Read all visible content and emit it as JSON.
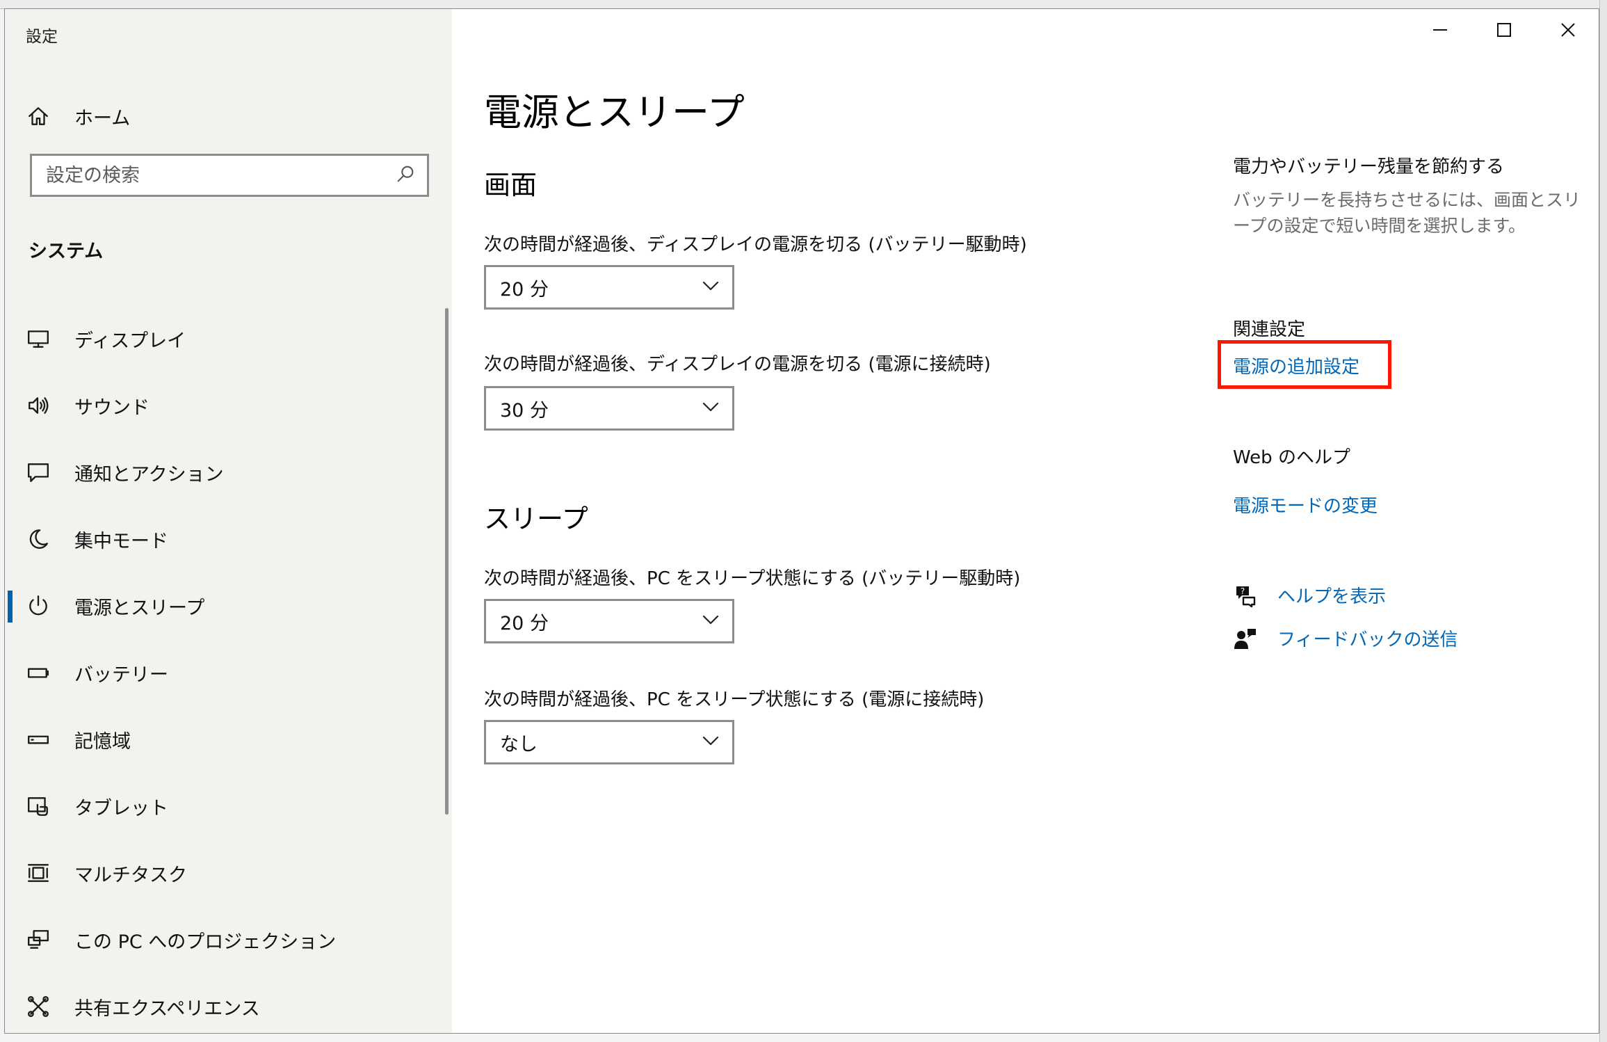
{
  "window": {
    "app_title": "設定",
    "controls": {
      "minimize": "minimize-icon",
      "maximize": "maximize-icon",
      "close": "close-icon"
    }
  },
  "sidebar": {
    "home_label": "ホーム",
    "search_placeholder": "設定の検索",
    "section_label": "システム",
    "items": [
      {
        "label": "ディスプレイ",
        "icon": "display-icon"
      },
      {
        "label": "サウンド",
        "icon": "speaker-icon"
      },
      {
        "label": "通知とアクション",
        "icon": "notification-icon"
      },
      {
        "label": "集中モード",
        "icon": "moon-icon"
      },
      {
        "label": "電源とスリープ",
        "icon": "power-icon",
        "active": true
      },
      {
        "label": "バッテリー",
        "icon": "battery-icon"
      },
      {
        "label": "記憶域",
        "icon": "storage-icon"
      },
      {
        "label": "タブレット",
        "icon": "tablet-icon"
      },
      {
        "label": "マルチタスク",
        "icon": "multitask-icon"
      },
      {
        "label": "この PC へのプロジェクション",
        "icon": "projection-icon"
      },
      {
        "label": "共有エクスペリエンス",
        "icon": "share-icon"
      }
    ]
  },
  "main": {
    "page_title": "電源とスリープ",
    "screen": {
      "title": "画面",
      "battery_label": "次の時間が経過後、ディスプレイの電源を切る (バッテリー駆動時)",
      "battery_value": "20 分",
      "plugged_label": "次の時間が経過後、ディスプレイの電源を切る (電源に接続時)",
      "plugged_value": "30 分"
    },
    "sleep": {
      "title": "スリープ",
      "battery_label": "次の時間が経過後、PC をスリープ状態にする (バッテリー駆動時)",
      "battery_value": "20 分",
      "plugged_label": "次の時間が経過後、PC をスリープ状態にする (電源に接続時)",
      "plugged_value": "なし"
    }
  },
  "right": {
    "save_heading": "電力やバッテリー残量を節約する",
    "save_desc": "バッテリーを長持ちさせるには、画面とスリープの設定で短い時間を選択します。",
    "related_heading": "関連設定",
    "related_link": "電源の追加設定",
    "web_help_heading": "Web のヘルプ",
    "web_help_link": "電源モードの変更",
    "help_link": "ヘルプを表示",
    "feedback_link": "フィードバックの送信",
    "highlight_color": "#ff1500",
    "link_color": "#0067b8"
  }
}
